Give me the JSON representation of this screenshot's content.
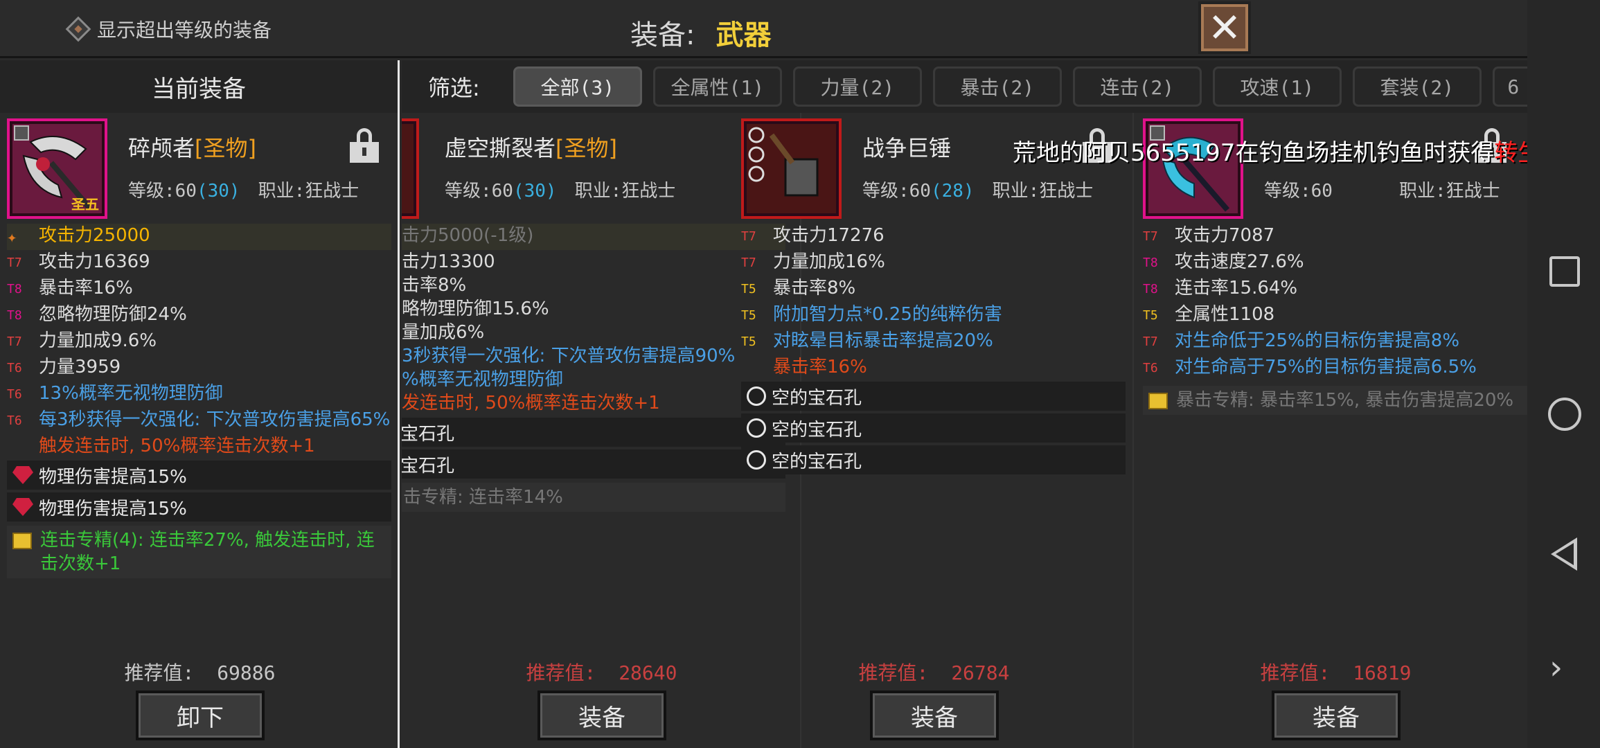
{
  "topbar": {
    "toggle_label": "显示超出等级的装备",
    "title_label": "装备:",
    "title_value": "武器",
    "close_glyph": "✕"
  },
  "left": {
    "header": "当前装备",
    "item": {
      "name": "碎颅者",
      "tag": "[圣物]",
      "level_label": "等级:60",
      "level_extra": "(30)",
      "job": "职业:狂战士",
      "badge": "圣五"
    },
    "attrs": [
      {
        "tier": "",
        "text": "攻击力25000",
        "color": "gold",
        "hl": true
      },
      {
        "tier": "T7",
        "text": "攻击力16369",
        "color": "white"
      },
      {
        "tier": "T8",
        "text": "暴击率16%",
        "color": "white"
      },
      {
        "tier": "T8",
        "text": "忽略物理防御24%",
        "color": "white"
      },
      {
        "tier": "T7",
        "text": "力量加成9.6%",
        "color": "white"
      },
      {
        "tier": "T6",
        "text": "力量3959",
        "color": "white"
      },
      {
        "tier": "T6",
        "text": "13%概率无视物理防御",
        "color": "blue"
      },
      {
        "tier": "T6",
        "text": "每3秒获得一次强化: 下次普攻伤害提高65%",
        "color": "blue"
      },
      {
        "tier": "",
        "text": "触发连击时, 50%概率连击次数+1",
        "color": "orange"
      }
    ],
    "gems": [
      "物理伤害提高15%",
      "物理伤害提高15%"
    ],
    "spec": "连击专精(4): 连击率27%, 触发连击时, 连击次数+1",
    "rec_label": "推荐值:",
    "rec_value": "69886",
    "button": "卸下"
  },
  "filter": {
    "label": "筛选:",
    "tabs": [
      "全部(3)",
      "全属性(1)",
      "力量(2)",
      "暴击(2)",
      "连击(2)",
      "攻速(1)",
      "套装(2)",
      "6"
    ]
  },
  "cols": [
    {
      "name": "虚空撕裂者",
      "tag": "[圣物]",
      "level_label": "等级:60",
      "level_extra": "(30)",
      "job": "职业:狂战士",
      "attrs": [
        {
          "tier": "",
          "text": "击力5000(-1级)",
          "color": "dim",
          "hl": true
        },
        {
          "tier": "",
          "text": "击力13300",
          "color": "white"
        },
        {
          "tier": "",
          "text": "击率8%",
          "color": "white"
        },
        {
          "tier": "",
          "text": "略物理防御15.6%",
          "color": "white"
        },
        {
          "tier": "",
          "text": "量加成6%",
          "color": "white"
        },
        {
          "tier": "",
          "text": "3秒获得一次强化: 下次普攻伤害提高90%",
          "color": "blue"
        },
        {
          "tier": "",
          "text": "%概率无视物理防御",
          "color": "blue"
        },
        {
          "tier": "",
          "text": "发连击时, 50%概率连击次数+1",
          "color": "orange"
        }
      ],
      "slots": [
        "宝石孔",
        "宝石孔"
      ],
      "spec": "击专精: 连击率14%",
      "rec_label": "推荐值:",
      "rec_value": "28640",
      "button": "装备"
    },
    {
      "name": "战争巨锤",
      "tag": "",
      "level_label": "等级:60",
      "level_extra": "(28)",
      "job": "职业:狂战士",
      "attrs": [
        {
          "tier": "T7",
          "text": "攻击力17276",
          "color": "white"
        },
        {
          "tier": "T7",
          "text": "力量加成16%",
          "color": "white"
        },
        {
          "tier": "T5",
          "text": "暴击率8%",
          "color": "white"
        },
        {
          "tier": "T5",
          "text": "附加智力点*0.25的纯粹伤害",
          "color": "blue"
        },
        {
          "tier": "T5",
          "text": "对眩晕目标暴击率提高20%",
          "color": "blue"
        },
        {
          "tier": "",
          "text": "暴击率16%",
          "color": "orange"
        }
      ],
      "slots": [
        "空的宝石孔",
        "空的宝石孔",
        "空的宝石孔"
      ],
      "rec_label": "推荐值:",
      "rec_value": "26784",
      "button": "装备"
    },
    {
      "name": "",
      "tag": "",
      "level_label": "等级:60",
      "level_extra": "",
      "job": "职业:狂战士",
      "attrs": [
        {
          "tier": "T7",
          "text": "攻击力7087",
          "color": "white"
        },
        {
          "tier": "T8",
          "text": "攻击速度27.6%",
          "color": "white"
        },
        {
          "tier": "T8",
          "text": "连击率15.64%",
          "color": "white"
        },
        {
          "tier": "T5",
          "text": "全属性1108",
          "color": "white"
        },
        {
          "tier": "T7",
          "text": "对生命低于25%的目标伤害提高8%",
          "color": "blue"
        },
        {
          "tier": "T6",
          "text": "对生命高于75%的目标伤害提高6.5%",
          "color": "blue"
        }
      ],
      "spec": "暴击专精: 暴击率15%, 暴击伤害提高20%",
      "rec_label": "推荐值:",
      "rec_value": "16819",
      "button": "装备"
    }
  ],
  "ticker": {
    "text": "荒地的阿贝5655197在钓鱼场挂机钓鱼时获得",
    "hot": "转生石"
  },
  "colors": {
    "rarity_border": "#e0128a",
    "tag_gold": "#f0a020",
    "level_extra": "#3ab0e0"
  }
}
